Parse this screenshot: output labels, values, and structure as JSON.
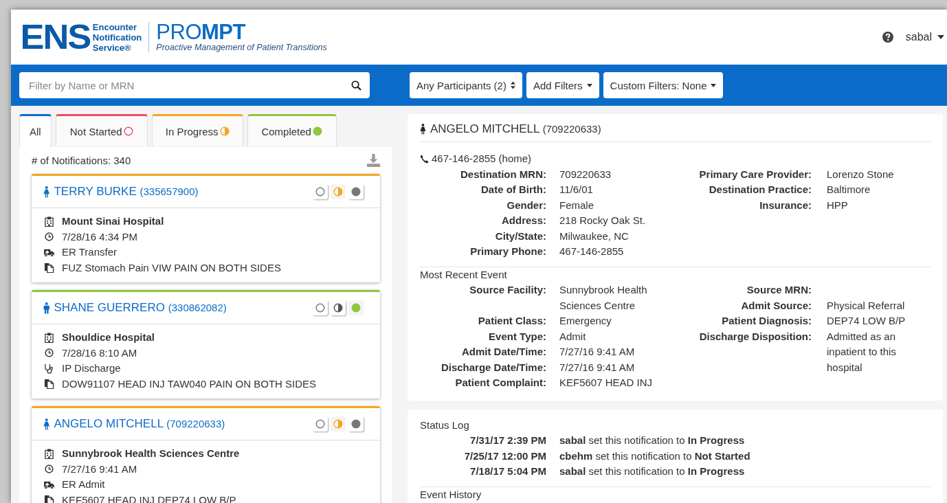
{
  "header": {
    "logo_mark": "ENS",
    "logo_lines": [
      "Encounter",
      "Notification",
      "Service®"
    ],
    "product": "PRO**MPT**",
    "tagline": "Proactive Management of Patient Transitions",
    "user": "sabal"
  },
  "filter_bar": {
    "search": {
      "placeholder": "Filter by Name or MRN"
    },
    "buttons": [
      {
        "label": "Any Participants (2)",
        "kind": "select"
      },
      {
        "label": "Add Filters",
        "kind": "dropdown"
      },
      {
        "label": "Custom Filters: None",
        "kind": "dropdown"
      }
    ]
  },
  "tabs": [
    {
      "label": "All",
      "kind": "all",
      "selected": true,
      "color": "#0a6cc8"
    },
    {
      "label": "Not Started",
      "kind": "not_started",
      "selected": false,
      "color": "#e8505b"
    },
    {
      "label": "In Progress",
      "kind": "in_progress",
      "selected": false,
      "color": "#f5a623"
    },
    {
      "label": "Completed",
      "kind": "completed",
      "selected": false,
      "color": "#8dc63f"
    }
  ],
  "count": "# of Notifications: 340",
  "cards": [
    {
      "person": {
        "kind": "female"
      },
      "name": "TERRY BURKE",
      "mrn": "(335657900)",
      "status_buttons": [
        {
          "kind": "not_started",
          "selected": false
        },
        {
          "kind": "in_progress",
          "selected": true
        },
        {
          "kind": "completed",
          "selected": false
        }
      ],
      "facility": "Mount Sinai Hospital",
      "time": "7/28/16 4:34 PM",
      "event": {
        "kind": "ambulance",
        "text": "ER Transfer"
      },
      "complaint": "FUZ Stomach Pain VIW PAIN ON BOTH SIDES"
    },
    {
      "person": {
        "kind": "male"
      },
      "name": "SHANE GUERRERO",
      "mrn": "(330862082)",
      "status_buttons": [
        {
          "kind": "not_started",
          "selected": false
        },
        {
          "kind": "in_progress",
          "selected": false
        },
        {
          "kind": "completed",
          "selected": true
        }
      ],
      "facility": "Shouldice Hospital",
      "time": "7/28/16 8:10 AM",
      "event": {
        "kind": "stethoscope",
        "text": "IP Discharge"
      },
      "complaint": "DOW91107 HEAD INJ TAW040 PAIN ON BOTH SIDES"
    },
    {
      "person": {
        "kind": "female"
      },
      "name": "ANGELO MITCHELL",
      "mrn": "(709220633)",
      "status_buttons": [
        {
          "kind": "not_started",
          "selected": false
        },
        {
          "kind": "in_progress",
          "selected": true
        },
        {
          "kind": "completed",
          "selected": false
        }
      ],
      "facility": "Sunnybrook Health Sciences Centre",
      "time": "7/27/16 9:41 AM",
      "event": {
        "kind": "ambulance",
        "text": "ER Admit"
      },
      "complaint": "KEF5607 HEAD INJ DEP74 LOW B/P"
    }
  ],
  "detail": {
    "person": {
      "kind": "female"
    },
    "name": "ANGELO MITCHELL",
    "mrn": "(709220633)",
    "phone": "467-146-2855 (home)",
    "patient_left": [
      {
        "label": "Destination MRN:",
        "value": "709220633"
      },
      {
        "label": "Date of Birth:",
        "value": "11/6/01"
      },
      {
        "label": "Gender:",
        "value": "Female"
      },
      {
        "label": "Address:",
        "value": "218 Rocky Oak St."
      },
      {
        "label": "City/State:",
        "value": "Milwaukee, NC"
      },
      {
        "label": "Primary Phone:",
        "value": "467-146-2855"
      }
    ],
    "patient_right": [
      {
        "label": "Primary Care Provider:",
        "value": "Lorenzo Stone"
      },
      {
        "label": "Destination Practice:",
        "value": "Baltimore"
      },
      {
        "label": "Insurance:",
        "value": "HPP"
      }
    ],
    "event_title": "Most Recent Event",
    "event_left": [
      {
        "label": "Source Facility:",
        "value": "Sunnybrook Health Sciences Centre"
      },
      {
        "label": "Patient Class:",
        "value": "Emergency"
      },
      {
        "label": "Event Type:",
        "value": "Admit"
      },
      {
        "label": "Admit Date/Time:",
        "value": "7/27/16 9:41 AM"
      },
      {
        "label": "Discharge Date/Time:",
        "value": "7/27/16 9:41 AM"
      },
      {
        "label": "Patient Complaint:",
        "value": "KEF5607 HEAD INJ"
      }
    ],
    "event_right": [
      {
        "label": "Source MRN:"
      },
      {
        "label": "Admit Source:",
        "value": "Physical Referral"
      },
      {
        "label": "Patient Diagnosis:",
        "value": "DEP74 LOW B/P"
      },
      {
        "label": "Discharge Disposition:",
        "value": "Admitted as an inpatient to this hospital"
      }
    ]
  },
  "status_log": {
    "title": "Status Log",
    "entries": [
      {
        "time": "7/31/17 2:39 PM",
        "text": "**sabal** set this notification to **In Progress**"
      },
      {
        "time": "7/25/17 12:00 PM",
        "text": "**cbehm** set this notification to **Not Started**"
      },
      {
        "time": "7/18/17 5:04 PM",
        "text": "**sabal** set this notification to **In Progress**"
      }
    ],
    "next_title": "Event History"
  }
}
